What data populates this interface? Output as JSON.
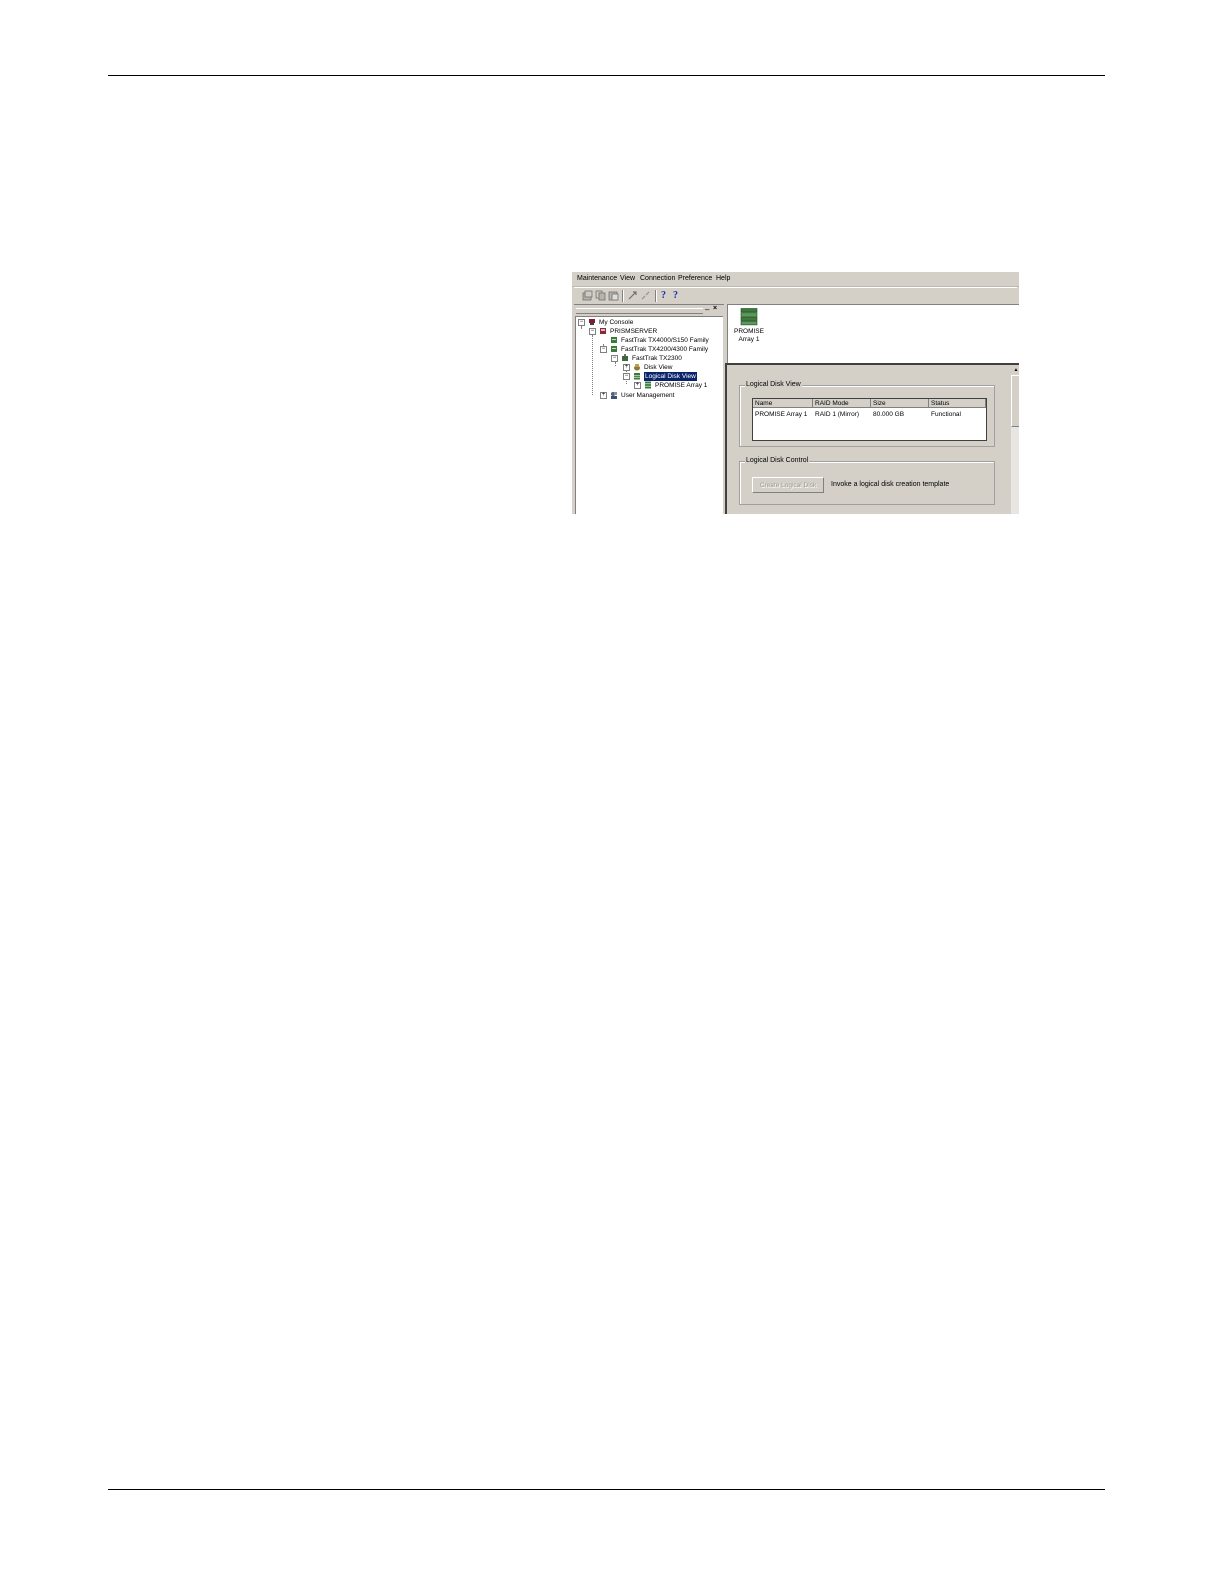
{
  "menu": {
    "items": [
      "Maintenance",
      "View",
      "Connection",
      "Preference",
      "Help"
    ]
  },
  "toolbar": {
    "icons": [
      "disk-icon",
      "copy-icon",
      "paste-icon",
      "connect-icon",
      "disconnect-icon",
      "help-icon",
      "context-help-icon"
    ],
    "help_glyph": "?",
    "context_help_glyph": "?"
  },
  "tree_pane": {
    "minimize_glyph": "–",
    "close_glyph": "×",
    "nodes": [
      {
        "label": "My Console",
        "expander": "−"
      },
      {
        "label": "PRISMSERVER",
        "expander": "−"
      },
      {
        "label": "FastTrak TX4000/S150 Family",
        "expander": ""
      },
      {
        "label": "FastTrak TX4200/4300 Family",
        "expander": "−"
      },
      {
        "label": "FastTrak TX2300",
        "expander": "−"
      },
      {
        "label": "Disk View",
        "expander": "+"
      },
      {
        "label": "Logical Disk View",
        "expander": "−"
      },
      {
        "label": "PROMISE Array 1",
        "expander": "+"
      },
      {
        "label": "User Management",
        "expander": "+"
      }
    ]
  },
  "icon_pane": {
    "array_label_line1": "PROMISE",
    "array_label_line2": "Array 1"
  },
  "logical_disk_view": {
    "title": "Logical Disk View",
    "columns": [
      "Name",
      "RAID Mode",
      "Size",
      "Status"
    ],
    "rows": [
      [
        "PROMISE Array 1",
        "RAID 1 (Mirror)",
        "80.000 GB",
        "Functional"
      ]
    ]
  },
  "logical_disk_control": {
    "title": "Logical Disk Control",
    "button_label": "Create Logical Disk",
    "description": "Invoke a logical disk creation template"
  },
  "colors": {
    "window_bg": "#d4d0c8",
    "selection": "#0a246a",
    "help_blue": "#1a2fa8"
  }
}
